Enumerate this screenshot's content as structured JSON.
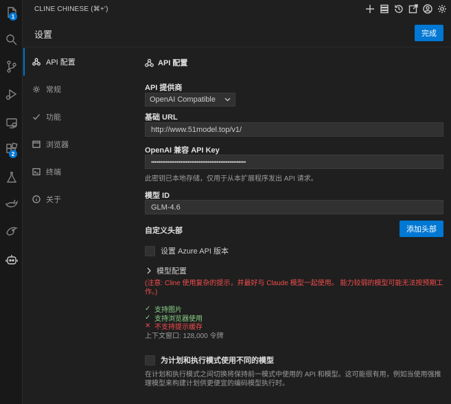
{
  "titlebar": {
    "title": "CLINE CHINESE (⌘+')"
  },
  "activity": {
    "badge_explorer": "1",
    "badge_extensions": "2"
  },
  "header": {
    "title": "设置",
    "done_label": "完成"
  },
  "nav": {
    "items": [
      {
        "label": "API 配置",
        "icon": "webhook-icon"
      },
      {
        "label": "常规",
        "icon": "gear-icon"
      },
      {
        "label": "功能",
        "icon": "check-icon"
      },
      {
        "label": "浏览器",
        "icon": "browser-icon"
      },
      {
        "label": "终端",
        "icon": "terminal-icon"
      },
      {
        "label": "关于",
        "icon": "info-icon"
      }
    ]
  },
  "main": {
    "section_title": "API 配置",
    "provider_label": "API 提供商",
    "provider_value": "OpenAI Compatible",
    "base_url_label": "基础 URL",
    "base_url_value": "http://www.51model.top/v1/",
    "api_key_label": "OpenAI 兼容 API Key",
    "api_key_value": "••••••••••••••••••••••••••••••••••••••••••••••••••••",
    "api_key_note": "此密钥已本地存储，仅用于从本扩展程序发出 API 请求。",
    "model_id_label": "模型 ID",
    "model_id_value": "GLM-4.6",
    "custom_headers_label": "自定义头部",
    "add_header_label": "添加头部",
    "azure_label": "设置 Azure API 版本",
    "model_config_label": "模型配置",
    "warning": "(注意: Cline 使用复杂的提示，并最好与 Claude 模型一起使用。 能力较弱的模型可能无法按预期工作。)",
    "capabilities": [
      {
        "mark": "✓",
        "label": "支持图片",
        "ok": true
      },
      {
        "mark": "✓",
        "label": "支持浏览器使用",
        "ok": true
      },
      {
        "mark": "✕",
        "label": "不支持提示缓存",
        "ok": false
      }
    ],
    "context_window": "上下文窗口: 128,000 令牌",
    "plan_act_label": "为计划和执行模式使用不同的模型",
    "plan_act_help": "在计划和执行模式之间切换将保持前一模式中使用的 API 和模型。这可能很有用，例如当使用强推理模型来构建计划供更便宜的编码模型执行时。"
  },
  "colors": {
    "accent": "#0078d4",
    "error": "#f14c4c",
    "success": "#89d185"
  }
}
